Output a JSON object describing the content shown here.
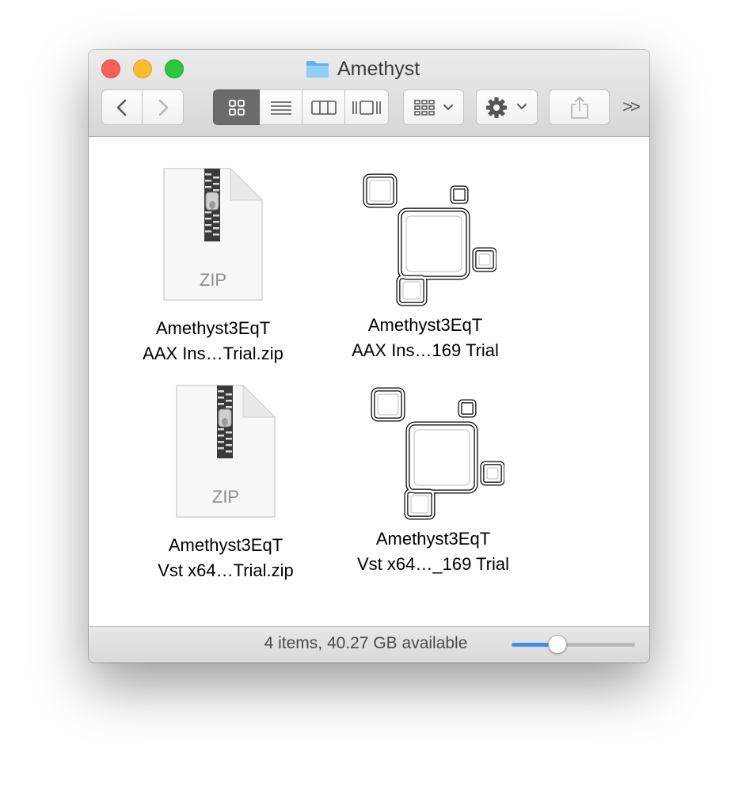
{
  "window": {
    "title": "Amethyst",
    "traffic_lights": [
      "close",
      "minimize",
      "zoom"
    ]
  },
  "toolbar": {
    "nav": {
      "back_icon": "chevron-left-icon",
      "forward_icon": "chevron-right-icon"
    },
    "view_modes": [
      {
        "icon": "icon-view-icon",
        "active": true
      },
      {
        "icon": "list-view-icon",
        "active": false
      },
      {
        "icon": "column-view-icon",
        "active": false
      },
      {
        "icon": "cover-flow-icon",
        "active": false
      }
    ],
    "arrange_icon": "arrange-grid-icon",
    "action_icon": "gear-icon",
    "share_icon": "share-icon",
    "overflow_label": ">>"
  },
  "files": [
    {
      "line1": "Amethyst3EqT",
      "line2": "AAX Ins…Trial.zip",
      "kind": "zip",
      "badge": "ZIP"
    },
    {
      "line1": "Amethyst3EqT",
      "line2": "AAX Ins…169 Trial",
      "kind": "app"
    },
    {
      "line1": "Amethyst3EqT",
      "line2": "Vst x64…Trial.zip",
      "kind": "zip",
      "badge": "ZIP"
    },
    {
      "line1": "Amethyst3EqT",
      "line2": "Vst x64…_169 Trial",
      "kind": "app"
    }
  ],
  "status": {
    "text": "4 items, 40.27 GB available",
    "icon_size_fraction": 0.35
  },
  "colors": {
    "close": "#fc5f57",
    "minimize": "#fdbc2e",
    "zoom": "#28c840",
    "accent": "#3c8ef5",
    "folder": "#6fc0f4"
  }
}
